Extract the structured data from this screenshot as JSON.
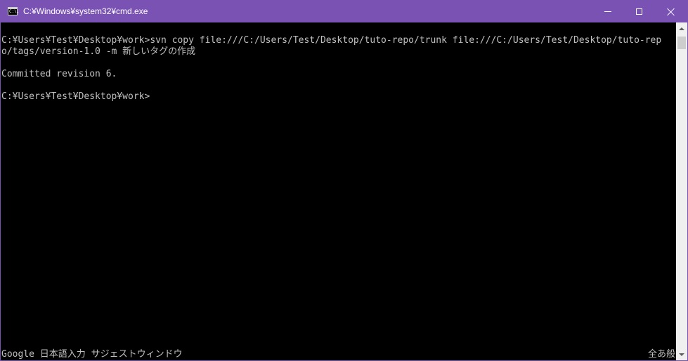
{
  "window": {
    "title": "C:¥Windows¥system32¥cmd.exe",
    "icon": "cmd-icon",
    "icon_glyph": "C:\\.",
    "titlebar_color": "#7952b3",
    "controls": {
      "minimize": "minimize-icon",
      "maximize": "maximize-icon",
      "close": "close-icon"
    }
  },
  "console": {
    "background": "#000000",
    "foreground": "#c0c0c0",
    "lines": [
      "C:¥Users¥Test¥Desktop¥work>svn copy file:///C:/Users/Test/Desktop/tuto-repo/trunk file:///C:/Users/Test/Desktop/tuto-rep",
      "o/tags/version-1.0 -m 新しいタグの作成",
      "Committed revision 6.",
      "C:¥Users¥Test¥Desktop¥work>"
    ],
    "ime_status_left": "Google 日本語入力 サジェストウィンドウ",
    "ime_status_right": "全あ般"
  },
  "scrollbar": {
    "up_icon": "scroll-up-arrow-icon",
    "down_icon": "scroll-down-arrow-icon"
  }
}
